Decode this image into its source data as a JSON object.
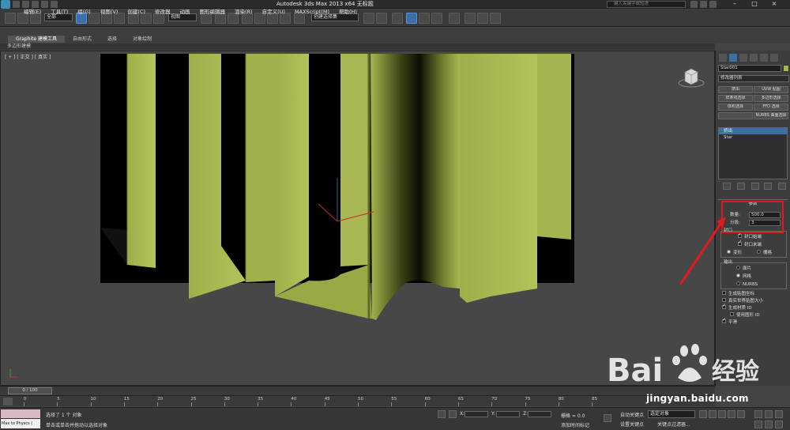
{
  "titlebar": {
    "title": "Autodesk 3ds Max  2013 x64      无标题",
    "search_placeholder": "键入关键字或短语",
    "menus": [
      "编辑(E)",
      "工具(T)",
      "组(G)",
      "视图(V)",
      "创建(C)",
      "修改器",
      "动画",
      "图形编辑器",
      "渲染(R)",
      "自定义(U)",
      "MAXScript(M)",
      "帮助(H)"
    ]
  },
  "toolbar": {
    "selection_filter": "全部",
    "ref_coord": "视图",
    "named_selection": "创建选择集"
  },
  "ribbon": {
    "tabs": [
      "Graphite 建模工具",
      "自由形式",
      "选择",
      "对象绘制"
    ],
    "sub_label": "多边形建模"
  },
  "viewport": {
    "label": "[ + ] [ 正交 ] [ 真实 ]"
  },
  "command_panel": {
    "object_name": "Star001",
    "object_color": "#a6b74a",
    "modifier_list": "修改器列表",
    "modifier_buttons": [
      "挤出",
      "UVW 贴图",
      "样条线选择",
      "多边形选择",
      "体积选择",
      "FFD 选择",
      "",
      "NURBS 曲面选择"
    ],
    "stack": [
      "挤出",
      "Star"
    ],
    "params_title": "参数",
    "amount_label": "数量:",
    "amount_value": "500.0",
    "segments_label": "分段:",
    "segments_value": "3",
    "capping_label": "封口",
    "cap_start": "封口始端",
    "cap_end": "封口末端",
    "morph": "变形",
    "grid": "栅格",
    "output_label": "输出",
    "out_patch": "面片",
    "out_mesh": "网格",
    "out_nurbs": "NURBS",
    "gen_map": "生成贴图坐标",
    "real_world": "真实世界贴图大小",
    "gen_mat": "生成材质 ID",
    "use_shape": "使用图形 ID",
    "smooth": "平滑"
  },
  "timeline": {
    "frame": "0 / 100",
    "ticks": [
      "0",
      "5",
      "10",
      "15",
      "20",
      "25",
      "30",
      "35",
      "40",
      "45",
      "50",
      "55",
      "60",
      "65",
      "70",
      "75",
      "80",
      "85"
    ]
  },
  "status": {
    "maxscript": "Max to Physcs (",
    "selected": "选择了 1 个 对象",
    "prompt": "单击或单击并拖动以选择对象",
    "x_label": "X:",
    "y_label": "Y:",
    "z_label": "Z:",
    "grid": "栅格 = 0.0",
    "auto_key": "自动关键点",
    "set_key": "设置关键点",
    "selected_obj": "选定对象",
    "key_filter": "关键点过滤器...",
    "add_tag": "添加时间标记"
  },
  "watermark": {
    "url": "jingyan.baidu.com"
  }
}
